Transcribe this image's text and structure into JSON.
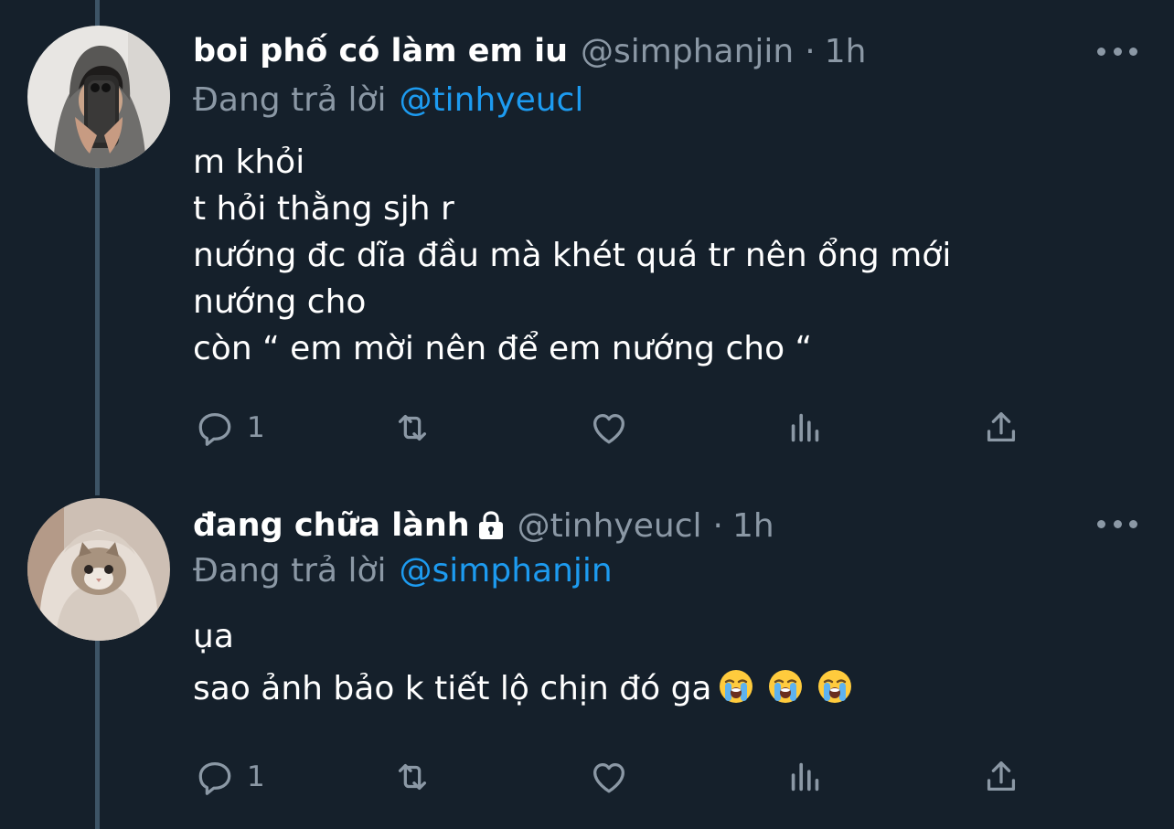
{
  "tweets": [
    {
      "display_name": "boi phố có làm em iu",
      "handle": "@simphanjin",
      "separator": "·",
      "time": "1h",
      "replying_label": "Đang trả lời",
      "replying_to": "@tinhyeucl",
      "body_lines": [
        "m khỏi",
        "t hỏi thằng sjh r",
        "nướng đc dĩa đầu mà khét quá tr nên ổng mới",
        "nướng cho",
        "còn “ em mời nên để em nướng cho “"
      ],
      "reply_count": "1",
      "avatar_icon": "avatar-man-mirror-selfie"
    },
    {
      "display_name": "đang chữa lành",
      "locked": true,
      "handle": "@tinhyeucl",
      "separator": "·",
      "time": "1h",
      "replying_label": "Đang trả lời",
      "replying_to": "@simphanjin",
      "body_lines": [
        "ụa",
        "sao ảnh bảo k tiết lộ chịn đó ga"
      ],
      "emoji": [
        "loudly-crying-face",
        "loudly-crying-face",
        "loudly-crying-face"
      ],
      "reply_count": "1",
      "avatar_icon": "avatar-cat-in-blanket"
    }
  ],
  "colors": {
    "background": "#15202b",
    "secondary_text": "#8b98a5",
    "link": "#1d9bf0",
    "thread_line": "#3d5466"
  }
}
